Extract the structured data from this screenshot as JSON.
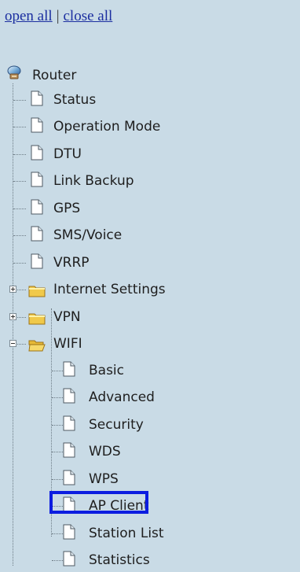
{
  "top_links": {
    "open_all": "open all",
    "separator": "|",
    "close_all": "close all"
  },
  "tree": {
    "root": {
      "label": "Router",
      "icon": "router-icon"
    },
    "items": [
      {
        "label": "Status",
        "icon": "page-icon"
      },
      {
        "label": "Operation Mode",
        "icon": "page-icon"
      },
      {
        "label": "DTU",
        "icon": "page-icon"
      },
      {
        "label": "Link Backup",
        "icon": "page-icon"
      },
      {
        "label": "GPS",
        "icon": "page-icon"
      },
      {
        "label": "SMS/Voice",
        "icon": "page-icon"
      },
      {
        "label": "VRRP",
        "icon": "page-icon"
      }
    ],
    "folders": [
      {
        "label": "Internet Settings",
        "state": "collapsed",
        "icon": "folder-closed-icon"
      },
      {
        "label": "VPN",
        "state": "collapsed",
        "icon": "folder-closed-icon"
      },
      {
        "label": "WIFI",
        "state": "expanded",
        "icon": "folder-open-icon",
        "children": [
          {
            "label": "Basic",
            "icon": "page-icon"
          },
          {
            "label": "Advanced",
            "icon": "page-icon"
          },
          {
            "label": "Security",
            "icon": "page-icon"
          },
          {
            "label": "WDS",
            "icon": "page-icon"
          },
          {
            "label": "WPS",
            "icon": "page-icon"
          },
          {
            "label": "AP Client",
            "icon": "page-icon",
            "selected": true
          },
          {
            "label": "Station List",
            "icon": "page-icon"
          },
          {
            "label": "Statistics",
            "icon": "page-icon"
          }
        ]
      }
    ]
  },
  "colors": {
    "background": "#c9dbe6",
    "link": "#1b2ea0",
    "selection_border": "#0c1de0",
    "folder": "#f0c94a"
  }
}
